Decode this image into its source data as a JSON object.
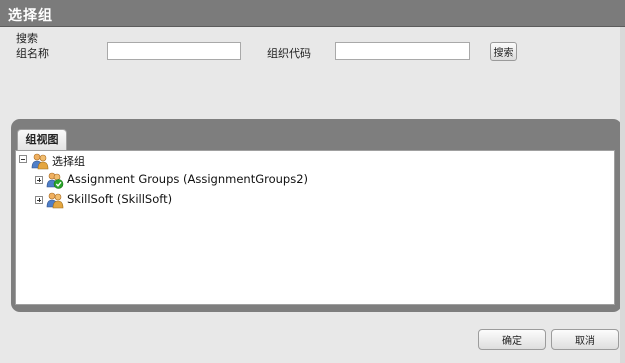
{
  "dialog": {
    "title": "选择组"
  },
  "search": {
    "section_label": "搜索",
    "group_name_label": "组名称",
    "group_name_value": "",
    "org_code_label": "组织代码",
    "org_code_value": "",
    "search_button": "搜索"
  },
  "tab": {
    "label": "组视图"
  },
  "tree": {
    "root": {
      "label": "选择组",
      "icon": "group-users-icon"
    },
    "children": [
      {
        "label": "Assignment Groups (AssignmentGroups2)",
        "icon": "group-checked-icon"
      },
      {
        "label": "SkillSoft (SkillSoft)",
        "icon": "group-users-icon"
      }
    ]
  },
  "footer": {
    "ok_button": "确定",
    "cancel_button": "取消"
  },
  "colors": {
    "titlebar": "#7b7b7b",
    "panel": "#7e7e7e",
    "check": "#2aa52a"
  }
}
